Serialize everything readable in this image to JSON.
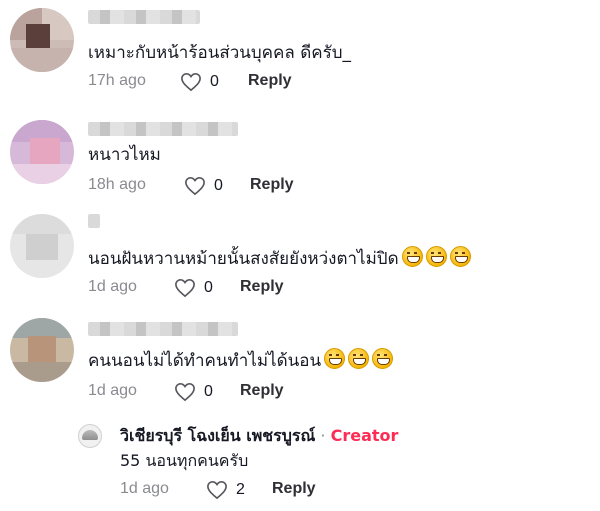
{
  "comments": [
    {
      "text": "เหมาะกับหน้าร้อนส่วนบุคคล ดีครับ_",
      "time": "17h ago",
      "likes": "0",
      "reply": "Reply",
      "emojis": 0
    },
    {
      "text": "หนาวไหม",
      "time": "18h ago",
      "likes": "0",
      "reply": "Reply",
      "emojis": 0
    },
    {
      "text": "นอนฝันหวานหม้ายนั้นสงสัยยังหว่งตาไม่ปิด",
      "time": "1d ago",
      "likes": "0",
      "reply": "Reply",
      "emojis": 3,
      "emoji_icon": "grimacing-face-emoji"
    },
    {
      "text": "คนนอนไม่ได้ทำคนทำไม่ได้นอน",
      "time": "1d ago",
      "likes": "0",
      "reply": "Reply",
      "emojis": 3,
      "emoji_icon": "grinning-squinting-face-emoji"
    }
  ],
  "creator_reply": {
    "name": "วิเชียรบุรี โฉงเย็น เพชรบูรณ์",
    "separator": " · ",
    "badge": "Creator",
    "text": "55 นอนทุกคนครับ",
    "time": "1d ago",
    "likes": "2",
    "reply": "Reply"
  },
  "colors": {
    "creator_badge": "#fe2c55",
    "meta_text": "#8a8b91"
  }
}
